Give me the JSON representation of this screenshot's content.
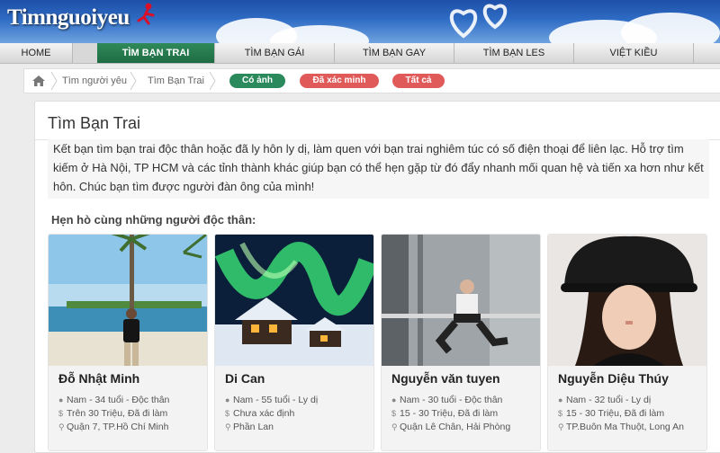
{
  "header": {
    "logo": "Timnguoiyeu"
  },
  "nav": {
    "items": [
      {
        "label": "HOME",
        "active": false
      },
      {
        "label": "TÌM BẠN TRAI",
        "active": true
      },
      {
        "label": "TÌM BẠN GÁI",
        "active": false
      },
      {
        "label": "TÌM BẠN GAY",
        "active": false
      },
      {
        "label": "TÌM BẠN LES",
        "active": false
      },
      {
        "label": "VIỆT KIỀU",
        "active": false
      }
    ]
  },
  "breadcrumb": {
    "items": [
      "Tìm người yêu",
      "Tìm Bạn Trai"
    ],
    "filters": [
      {
        "label": "Có ảnh",
        "color": "#2a8a5c"
      },
      {
        "label": "Đã xác minh",
        "color": "#e05a5a"
      },
      {
        "label": "Tất cả",
        "color": "#e05a5a"
      }
    ]
  },
  "main": {
    "title": "Tìm Bạn Trai",
    "intro": "Kết bạn tìm bạn trai độc thân hoặc đã ly hôn ly dị, làm quen với bạn trai nghiêm túc có số điện thoại để liên lạc. Hỗ trợ tìm kiếm ở Hà Nội, TP HCM và các tỉnh thành khác giúp bạn có thể hẹn gặp từ đó đẩy nhanh mối quan hệ và tiến xa hơn như kết hôn. Chúc bạn tìm được người đàn ông của mình!",
    "subheading": "Hẹn hò cùng những người độc thân:"
  },
  "profiles": [
    {
      "name": "Đỗ Nhật Minh",
      "info": "Nam - 34 tuổi - Độc thân",
      "income": "Trên 30 Triệu, Đã đi làm",
      "location": "Quận 7, TP.Hồ Chí Minh"
    },
    {
      "name": "Di Can",
      "info": "Nam - 55 tuổi - Ly dị",
      "income": "Chưa xác định",
      "location": "Phần Lan"
    },
    {
      "name": "Nguyễn văn tuyen",
      "info": "Nam - 30 tuổi - Độc thân",
      "income": "15 - 30 Triệu, Đã đi làm",
      "location": "Quận Lê Chân, Hải Phòng"
    },
    {
      "name": "Nguyễn Diệu Thúy",
      "info": "Nam - 32 tuổi - Ly dị",
      "income": "15 - 30 Triệu, Đã đi làm",
      "location": "TP.Buôn Ma Thuột, Long An"
    }
  ],
  "icons": {
    "person": "person-icon",
    "money": "dollar-icon",
    "pin": "map-pin-icon",
    "home": "home-icon"
  }
}
